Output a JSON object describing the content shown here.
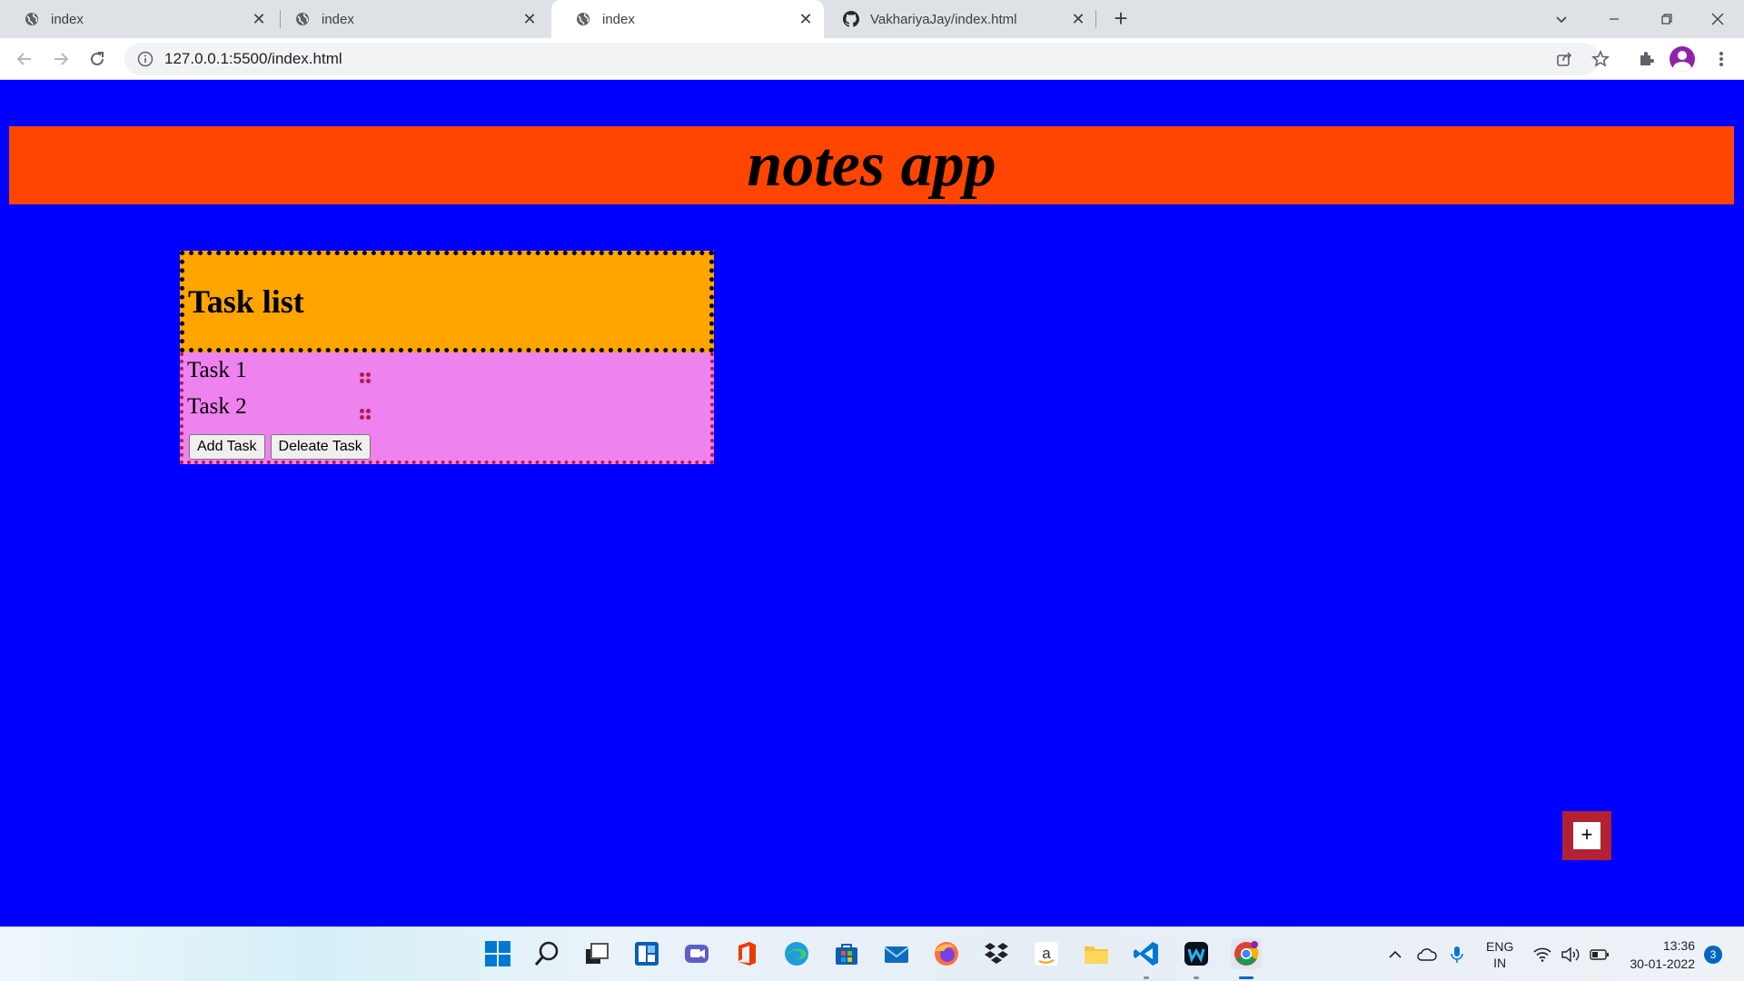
{
  "browser": {
    "tabs": [
      {
        "title": "index",
        "favicon": "globe-icon",
        "active": false
      },
      {
        "title": "index",
        "favicon": "globe-icon",
        "active": false
      },
      {
        "title": "index",
        "favicon": "globe-icon",
        "active": true
      },
      {
        "title": "VakhariyaJay/index.html",
        "favicon": "github-icon",
        "active": false
      }
    ],
    "new_tab_label": "+",
    "url": "127.0.0.1:5500/index.html"
  },
  "page": {
    "title": "notes app",
    "task_list_heading": "Task list",
    "tasks": [
      "Task 1",
      "Task 2"
    ],
    "add_button": "Add Task",
    "delete_button": "Deleate Task",
    "fab_label": "+"
  },
  "taskbar": {
    "apps": [
      "windows-start-icon",
      "search-icon",
      "task-view-icon",
      "widgets-icon",
      "teams-chat-icon",
      "office-icon",
      "edge-icon",
      "store-icon",
      "mail-icon",
      "firefox-icon",
      "dropbox-icon",
      "amazon-icon",
      "file-explorer-icon",
      "vscode-icon",
      "webex-icon",
      "chrome-icon"
    ],
    "language_line1": "ENG",
    "language_line2": "IN",
    "time": "13:36",
    "date": "30-01-2022",
    "notification_count": "3"
  },
  "colors": {
    "page_background": "#0000ff",
    "header_background": "#ff4500",
    "task_header_background": "#ffa500",
    "task_body_background": "#ee82ee",
    "fab_frame": "#b22233"
  }
}
